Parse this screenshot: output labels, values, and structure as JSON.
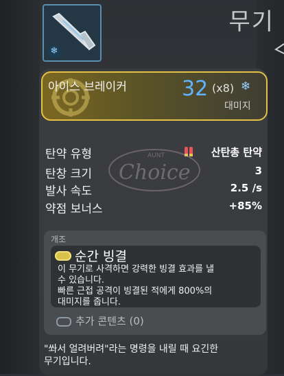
{
  "header": {
    "title": "무기"
  },
  "weapon": {
    "name": "아이스 브레이커",
    "damage": "32",
    "multiplier": "(x8)",
    "element_icon": "snowflake-icon",
    "damage_label": "대미지"
  },
  "stats": [
    {
      "label": "탄약 유형",
      "value": "산탄총 탄약",
      "icon": "shotgun-ammo-icon"
    },
    {
      "label": "탄창 크기",
      "value": "3"
    },
    {
      "label": "발사 속도",
      "value": "2.5 /s"
    },
    {
      "label": "약점 보너스",
      "value": "+85%"
    }
  ],
  "mods": {
    "section_label": "개조",
    "name": "순간 빙결",
    "description": [
      "이 무기로 사격하면 강력한 빙결 효과를 낼",
      "수 있습니다.",
      "빠른 근접 공격이 빙결된 적에게 800%의",
      "대미지를 줍니다."
    ],
    "extra_label": "추가 콘텐츠 (0)"
  },
  "flavor_text": [
    "\"쏴서 얼려버려\"라는 명령을 내릴 때 요긴한",
    "무기입니다."
  ],
  "watermark": {
    "text": "Choice",
    "small": "AUNT"
  },
  "colors": {
    "accent_gold": "#e6c244",
    "damage_blue": "#5fb4ff",
    "frost_blue": "#9bd2ff"
  }
}
